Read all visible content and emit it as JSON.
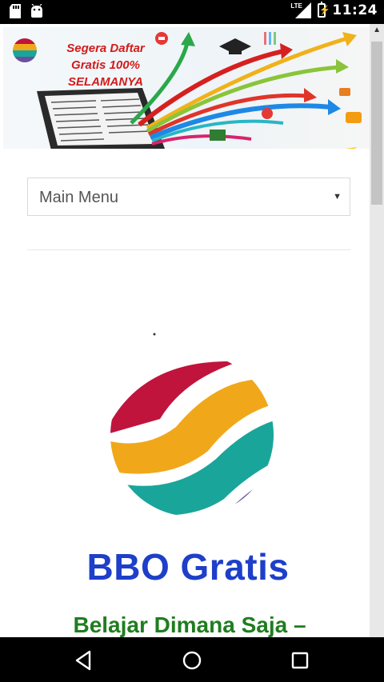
{
  "status_bar": {
    "time": "11:24",
    "network": "LTE",
    "icons": [
      "sd-card-icon",
      "android-icon",
      "lte-signal-icon",
      "battery-charging-icon"
    ]
  },
  "banner": {
    "text": "Segera Daftar Gratis 100% SELAMANYA",
    "line1": "Segera Daftar",
    "line2": "Gratis 100%",
    "line3": "SELAMANYA"
  },
  "menu": {
    "selected": "Main Menu"
  },
  "site": {
    "title": "BBO Gratis",
    "tagline": "Belajar Dimana Saja –"
  },
  "colors": {
    "title": "#1e3fc9",
    "tagline": "#1f7d1f",
    "banner_text": "#d21b1b",
    "logo_red": "#c0143c",
    "logo_yellow": "#f0a81a",
    "logo_teal": "#1aa59a",
    "logo_purple": "#6a4f9e"
  },
  "nav": {
    "buttons": [
      "back-icon",
      "home-icon",
      "recents-icon"
    ]
  }
}
